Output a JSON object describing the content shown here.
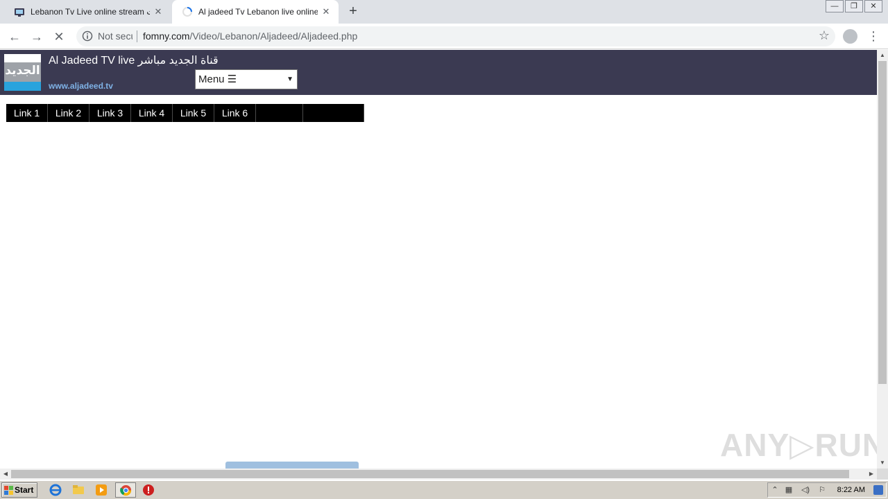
{
  "tabs": [
    {
      "title": "Lebanon Tv Live online stream شاشات",
      "active": false,
      "close": "✕"
    },
    {
      "title": "Al jadeed Tv Lebanon live online stre",
      "active": true,
      "close": "✕"
    }
  ],
  "new_tab": "+",
  "window_buttons": {
    "minimize": "—",
    "restore": "❐",
    "close": "✕"
  },
  "toolbar": {
    "back": "←",
    "forward": "→",
    "stop": "✕",
    "security_label": "Not secure",
    "url_host": "fomny.com",
    "url_path": "/Video/Lebanon/Aljadeed/Aljadeed.php",
    "star": "☆",
    "kebab": "⋮"
  },
  "header": {
    "logo_text": "الجديد",
    "title": "Al Jadeed TV live قناة الجديد مباشر",
    "site_url": "www.aljadeed.tv",
    "menu_label": "Menu ☰",
    "menu_arrow": "▼"
  },
  "links": [
    "Link 1",
    "Link 2",
    "Link 3",
    "Link 4",
    "Link 5",
    "Link 6",
    "",
    ""
  ],
  "watermark": "ANY▷RUN",
  "scroll": {
    "up": "▲",
    "down": "▼",
    "left": "◀",
    "right": "▶"
  },
  "taskbar": {
    "start_label": "Start",
    "clock": "8:22 AM"
  }
}
